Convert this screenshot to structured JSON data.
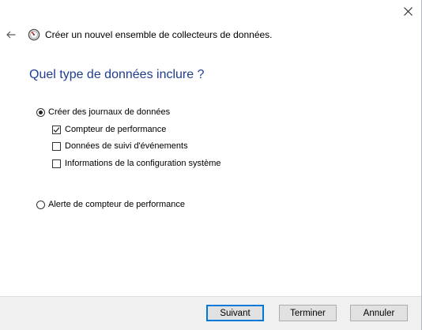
{
  "window": {
    "close_icon": "close-icon"
  },
  "header": {
    "back_icon": "back-arrow-icon",
    "app_icon": "performance-monitor-icon",
    "title": "Créer un nouvel ensemble de collecteurs de données."
  },
  "main": {
    "heading": "Quel type de données inclure ?",
    "option_logs": {
      "label": "Créer des journaux de données",
      "selected": true
    },
    "checkboxes": [
      {
        "label": "Compteur de performance",
        "checked": true
      },
      {
        "label": "Données de suivi d'événements",
        "checked": false
      },
      {
        "label": "Informations de la configuration système",
        "checked": false
      }
    ],
    "option_alert": {
      "label": "Alerte de compteur de performance",
      "selected": false
    }
  },
  "footer": {
    "next_label": "Suivant",
    "finish_label": "Terminer",
    "cancel_label": "Annuler"
  },
  "colors": {
    "heading": "#1e3d8f",
    "primary_border": "#0078d7",
    "footer_bg": "#f0f0f0"
  }
}
